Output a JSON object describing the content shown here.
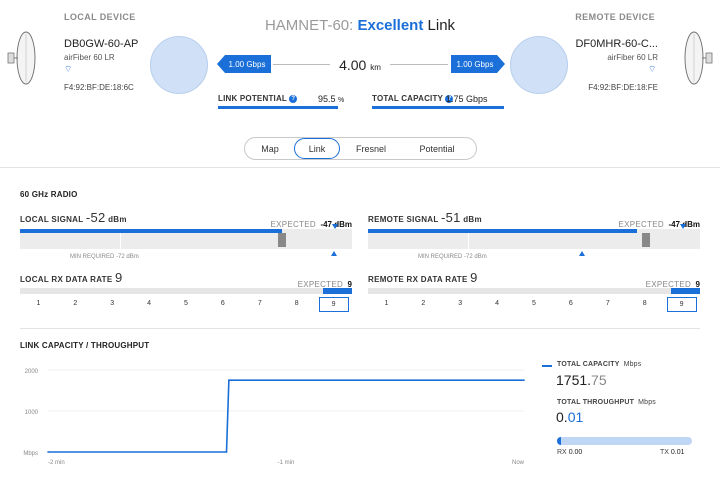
{
  "header": {
    "title_prefix": "HAMNET-60:",
    "title_quality": "Excellent",
    "title_suffix": "Link",
    "distance_value": "4.00",
    "distance_unit": "km",
    "local_rate": "1.00 Gbps",
    "remote_rate": "1.00 Gbps"
  },
  "local_device": {
    "caption": "LOCAL DEVICE",
    "name": "DB0GW-60-AP",
    "model": "airFiber 60 LR",
    "mac": "F4:92:BF:DE:18:6C"
  },
  "remote_device": {
    "caption": "REMOTE DEVICE",
    "name": "DF0MHR-60-C...",
    "model": "airFiber 60 LR",
    "mac": "F4:92:BF:DE:18:FE"
  },
  "metrics": {
    "link_potential_label": "LINK POTENTIAL",
    "link_potential_value": "95.5",
    "link_potential_unit": "%",
    "link_potential_fraction": 0.955,
    "total_capacity_label": "TOTAL CAPACITY",
    "total_capacity_value": "1.75 Gbps"
  },
  "tabs": [
    {
      "label": "Map",
      "active": false
    },
    {
      "label": "Link",
      "active": true
    },
    {
      "label": "Fresnel",
      "active": false
    },
    {
      "label": "Potential",
      "active": false
    }
  ],
  "radio": {
    "section_title": "60 GHz RADIO",
    "expected_label": "EXPECTED",
    "min_required_label": "MIN REQUIRED",
    "local_signal": {
      "label": "LOCAL SIGNAL",
      "value": "-52",
      "unit": "dBm",
      "expected": "-47 dBm",
      "min_required": "-72 dBm",
      "fill_fraction": 0.79
    },
    "remote_signal": {
      "label": "REMOTE SIGNAL",
      "value": "-51",
      "unit": "dBm",
      "expected": "-47 dBm",
      "min_required": "-72 dBm",
      "fill_fraction": 0.81
    },
    "local_rx": {
      "label": "LOCAL RX DATA RATE",
      "value": "9",
      "expected": "9",
      "scale": [
        "1",
        "2",
        "3",
        "4",
        "5",
        "6",
        "7",
        "8",
        "9"
      ]
    },
    "remote_rx": {
      "label": "REMOTE RX DATA RATE",
      "value": "9",
      "expected": "9",
      "scale": [
        "1",
        "2",
        "3",
        "4",
        "5",
        "6",
        "7",
        "8",
        "9"
      ]
    }
  },
  "capacity": {
    "section_title": "LINK CAPACITY / THROUGHPUT",
    "total_capacity_label": "TOTAL CAPACITY",
    "total_capacity_unit": "Mbps",
    "total_capacity_int": "1751.",
    "total_capacity_dec": "75",
    "total_throughput_label": "TOTAL THROUGHPUT",
    "total_throughput_unit": "Mbps",
    "total_throughput_int": "0.",
    "total_throughput_dec": "01",
    "throughput_fraction": 0.03,
    "rx_label": "RX",
    "rx_value": "0.00",
    "tx_label": "TX",
    "tx_value": "0.01"
  },
  "chart_data": {
    "type": "line",
    "title": "LINK CAPACITY / THROUGHPUT",
    "xlabel": "",
    "ylabel": "Mbps",
    "ylim": [
      0,
      2000
    ],
    "y_ticks": [
      "2000",
      "1000",
      "Mbps"
    ],
    "x_ticks": [
      "-2 min",
      "-1 min",
      "Now"
    ],
    "x": [
      -2.0,
      -1.25,
      -1.24,
      0.0
    ],
    "series": [
      {
        "name": "TOTAL CAPACITY",
        "values": [
          0,
          0,
          1751.75,
          1751.75
        ]
      }
    ],
    "grid": true,
    "legend": "right",
    "color": "#1a6fd8"
  }
}
